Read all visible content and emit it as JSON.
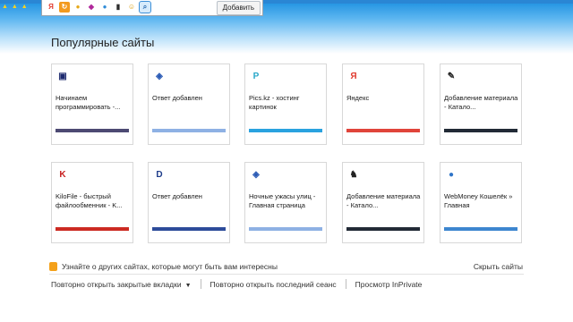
{
  "toolbar": {
    "add_button_label": "Добавить",
    "icons": [
      {
        "name": "yandex-icon",
        "glyph": "Я",
        "bg": "#ffffff",
        "fg": "#e23a2e"
      },
      {
        "name": "refresh-icon",
        "glyph": "↻",
        "bg": "#f39a1e",
        "fg": "#ffffff"
      },
      {
        "name": "search-globe-icon",
        "glyph": "●",
        "bg": "#ffffff",
        "fg": "#e6a818"
      },
      {
        "name": "media-icon",
        "glyph": "◆",
        "bg": "#ffffff",
        "fg": "#b0289b"
      },
      {
        "name": "ball-icon",
        "glyph": "●",
        "bg": "#ffffff",
        "fg": "#2f8cd8"
      },
      {
        "name": "book-icon",
        "glyph": "▮",
        "bg": "#ffffff",
        "fg": "#2c2c2c"
      },
      {
        "name": "smiley-icon",
        "glyph": "☺",
        "bg": "#ffffff",
        "fg": "#d99a00"
      },
      {
        "name": "search-icon",
        "glyph": "⌕",
        "bg": "#d7ebfb",
        "fg": "#2a6bb0"
      }
    ]
  },
  "page": {
    "heading": "Популярные сайты",
    "footer_note": "Узнайте о других сайтах, которые могут быть вам интересны",
    "hide_link": "Скрыть сайты",
    "reopen_tabs": "Повторно открыть закрытые вкладки",
    "reopen_session": "Повторно открыть последний сеанс",
    "inprivate": "Просмотр InPrivate"
  },
  "tiles": [
    {
      "label": "Начинаем программировать -...",
      "icon": "monitor-icon",
      "glyph": "▣",
      "fg": "#1d2a6e",
      "bar": "#4d4a73"
    },
    {
      "label": "Ответ добавлен",
      "icon": "diamond-icon",
      "glyph": "◈",
      "fg": "#2a5ab5",
      "bar": "#8eb1e4"
    },
    {
      "label": "Pics.kz - хостинг картинок",
      "icon": "pics-icon",
      "glyph": "P",
      "fg": "#29a8c9",
      "bar": "#2aa2df"
    },
    {
      "label": "Яндекс",
      "icon": "yandex-icon",
      "glyph": "Я",
      "fg": "#e03a2e",
      "bar": "#e0443a"
    },
    {
      "label": "Добавление материала - Катало...",
      "icon": "tool-icon",
      "glyph": "✎",
      "fg": "#222222",
      "bar": "#222a36"
    },
    {
      "label": "KiloFile - быстрый файлообменник - K...",
      "icon": "kilofile-icon",
      "glyph": "K",
      "fg": "#c81e1e",
      "bar": "#cc2a22"
    },
    {
      "label": "Ответ добавлен",
      "icon": "d-icon",
      "glyph": "D",
      "fg": "#1d3c8a",
      "bar": "#2d4c9a"
    },
    {
      "label": "Ночные ужасы улиц - Главная страница",
      "icon": "diamond-icon",
      "glyph": "◈",
      "fg": "#2a5ab5",
      "bar": "#8eb1e4"
    },
    {
      "label": "Добавление материала - Катало...",
      "icon": "tool-icon",
      "glyph": "♞",
      "fg": "#222222",
      "bar": "#222a36"
    },
    {
      "label": "WebMoney Кошелёк » Главная",
      "icon": "webmoney-icon",
      "glyph": "●",
      "fg": "#2f75c8",
      "bar": "#3d86cf"
    }
  ]
}
